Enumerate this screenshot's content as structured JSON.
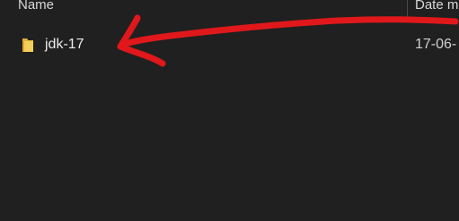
{
  "columns": {
    "name": "Name",
    "date_modified": "Date m"
  },
  "files": [
    {
      "name": "jdk-17",
      "date": "17-06-",
      "icon": "folder-icon"
    }
  ],
  "annotation": {
    "type": "hand-drawn-arrow",
    "color": "#e0181b"
  }
}
